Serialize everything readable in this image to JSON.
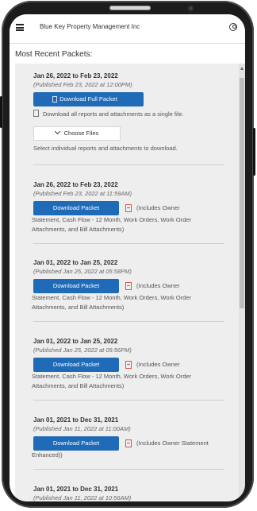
{
  "app": {
    "title": "Blue Key Property Management Inc"
  },
  "section_title": "Most Recent Packets:",
  "full_packet": {
    "title": "Jan 26, 2022 to Feb 23, 2022",
    "published": "(Published Feb 23, 2022 at 12:00PM)",
    "button_label": "Download Full Packet",
    "button_desc": "Download all reports and attachments as a single file.",
    "choose_label": "Choose Files",
    "choose_desc": "Select individual reports and attachments to download."
  },
  "packets": [
    {
      "title": "Jan 26, 2022 to Feb 23, 2022",
      "published": "(Published Feb 23, 2022 at 11:59AM)",
      "button_label": "Download Packet",
      "includes_first": "(Includes Owner",
      "includes_rest": "Statement, Cash Flow - 12 Month, Work Orders, Work Order Attachments, and Bill Attachments)"
    },
    {
      "title": "Jan 01, 2022 to Jan 25, 2022",
      "published": "(Published Jan 25, 2022 at 05:58PM)",
      "button_label": "Download Packet",
      "includes_first": "(Includes Owner",
      "includes_rest": "Statement, Cash Flow - 12 Month, Work Orders, Work Order Attachments, and Bill Attachments)"
    },
    {
      "title": "Jan 01, 2022 to Jan 25, 2022",
      "published": "(Published Jan 25, 2022 at 05:56PM)",
      "button_label": "Download Packet",
      "includes_first": "(Includes Owner",
      "includes_rest": "Statement, Cash Flow - 12 Month, Work Orders, Work Order Attachments, and Bill Attachments)"
    },
    {
      "title": "Jan 01, 2021 to Dec 31, 2021",
      "published": "(Published Jan 11, 2022 at 11:00AM)",
      "button_label": "Download Packet",
      "includes_first": "(Includes Owner Statement",
      "includes_rest": "Enhanced))"
    },
    {
      "title": "Jan 01, 2021 to Dec 31, 2021",
      "published": "(Published Jan 11, 2022 at 10:56AM)"
    }
  ],
  "colors": {
    "primary_button": "#1f6bb7",
    "pdf_icon": "#d9534f",
    "panel_bg": "#eeeeee"
  },
  "icons": [
    "menu-icon",
    "user-icon",
    "file-icon",
    "chevron-down-icon",
    "pdf-icon"
  ]
}
